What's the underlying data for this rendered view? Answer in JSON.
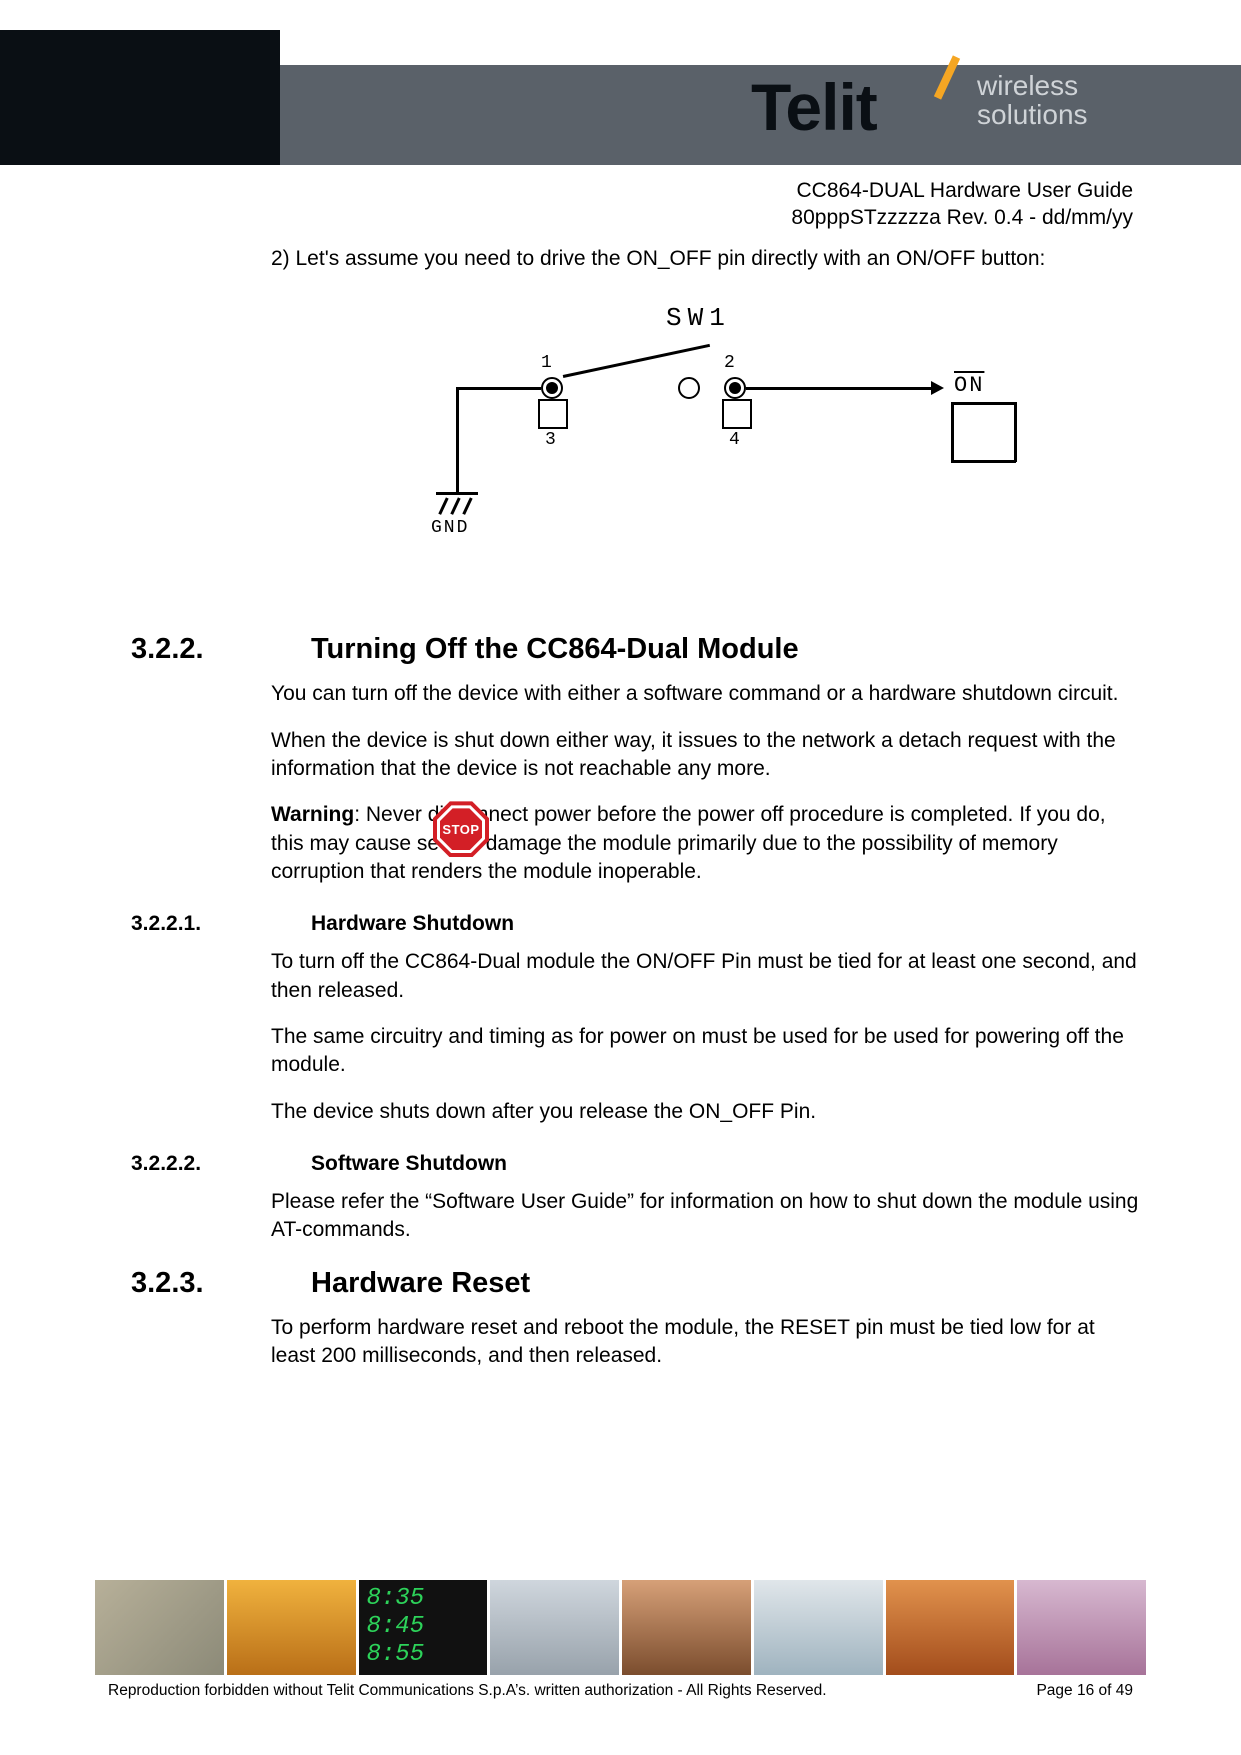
{
  "header": {
    "logo_name": "Telit",
    "tagline_line1": "wireless",
    "tagline_line2": "solutions",
    "doc_title": "CC864-DUAL Hardware User Guide",
    "doc_rev": "80pppSTzzzzza Rev. 0.4 - dd/mm/yy"
  },
  "intro_para": "2) Let's assume you need to drive the ON_OFF pin directly with an ON/OFF button:",
  "diagram": {
    "sw_label": "SW1",
    "pin1": "1",
    "pin2": "2",
    "pin3": "3",
    "pin4": "4",
    "gnd": "GND",
    "on": "ON"
  },
  "sections": {
    "s322_num": "3.2.2.",
    "s322_title": "Turning Off the CC864-Dual Module",
    "s322_p1": "You can turn off the device with either a software command or a hardware shutdown circuit.",
    "s322_p2": "When the device is shut down either way, it issues to the network a detach request with the information that the device is not reachable any more.",
    "s322_warning_label": "Warning",
    "s322_warning_body": ": Never disconnect power before the power off procedure is completed. If you do, this may cause severe damage the module primarily due to the possibility of memory corruption that renders the module inoperable.",
    "s3221_num": "3.2.2.1.",
    "s3221_title": "Hardware Shutdown",
    "s3221_p1": "To turn off the CC864-Dual module the ON/OFF Pin must be tied for at least one second, and then released.",
    "s3221_p2": "The same circuitry and timing as for power on must be used for be used for powering off the module.",
    "s3221_p3": "The device shuts down after you release the ON_OFF Pin.",
    "s3222_num": "3.2.2.2.",
    "s3222_title": "Software Shutdown",
    "s3222_p1": "Please refer the “Software User Guide” for information on how to shut down the module using AT-commands.",
    "s323_num": "3.2.3.",
    "s323_title": "Hardware Reset",
    "s323_p1": "To perform hardware reset and reboot the module, the RESET pin must be tied low for at least 200 milliseconds, and then released."
  },
  "footer": {
    "stop_label": "STOP",
    "time1": "8:35",
    "time2": "8:45",
    "time3": "8:55",
    "legal": "Reproduction forbidden without Telit Communications S.p.A’s. written authorization - All Rights Reserved.",
    "page": "Page 16 of 49"
  }
}
